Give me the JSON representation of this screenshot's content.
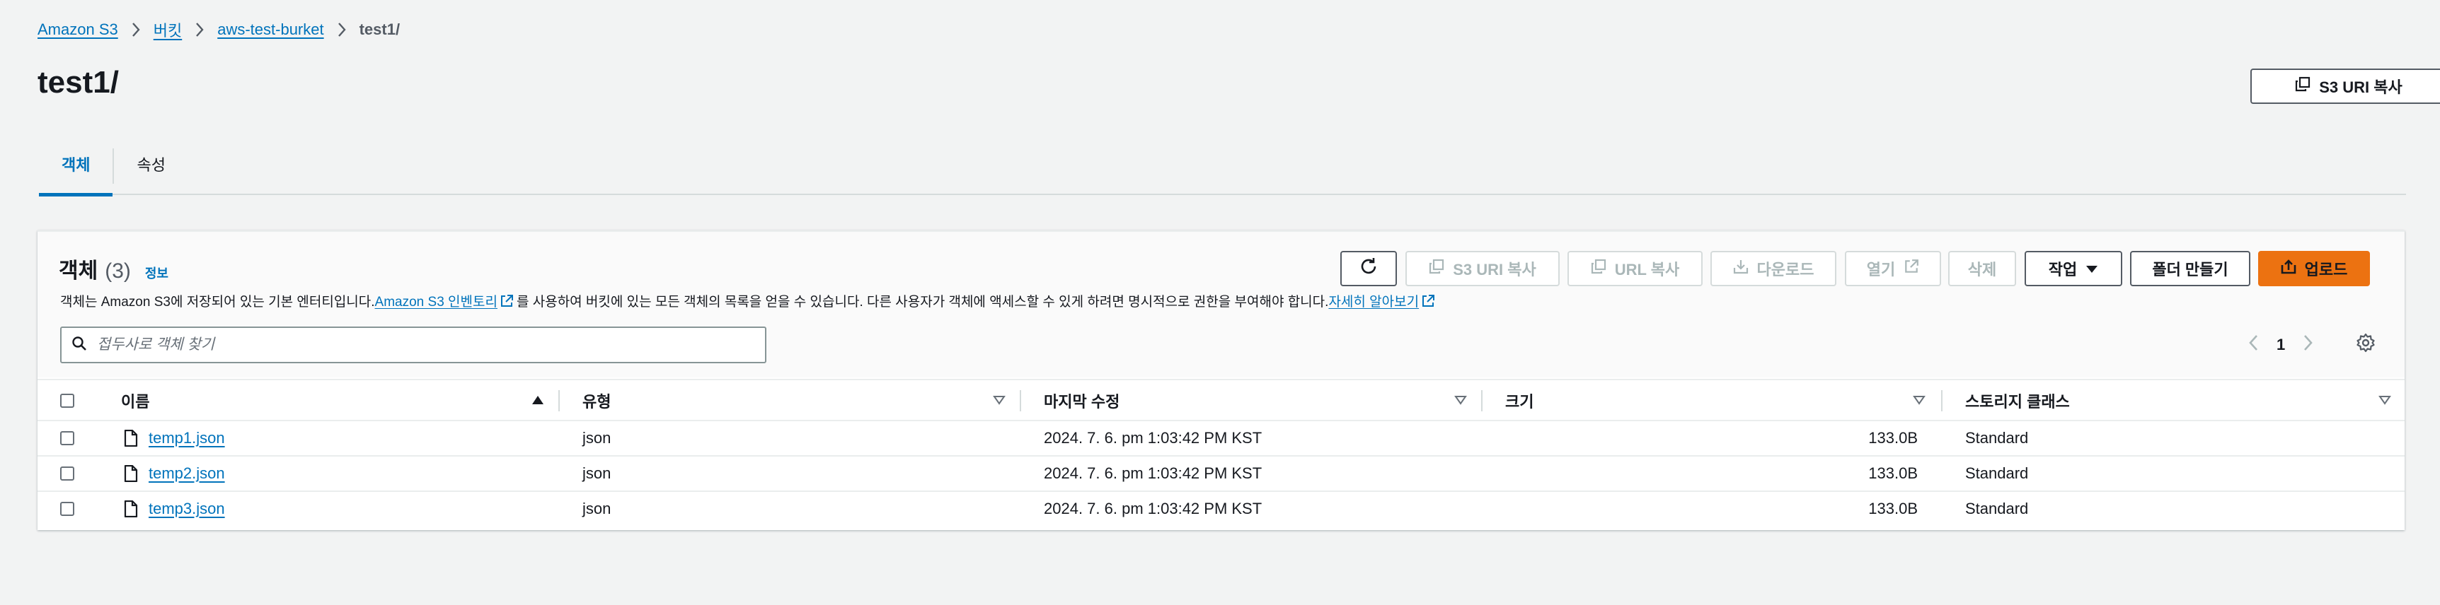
{
  "breadcrumb": {
    "items": [
      "Amazon S3",
      "버킷",
      "aws-test-burket"
    ],
    "current": "test1/"
  },
  "page": {
    "title": "test1/",
    "copy_uri_button": "S3 URI 복사"
  },
  "tabs": [
    {
      "label": "객체",
      "active": true
    },
    {
      "label": "속성",
      "active": false
    }
  ],
  "panel": {
    "title": "객체",
    "count": "(3)",
    "info_link": "정보",
    "description_1": "객체는 Amazon S3에 저장되어 있는 기본 엔터티입니다. ",
    "inventory_link": "Amazon S3 인벤토리",
    "description_2": "를 사용하여 버킷에 있는 모든 객체의 목록을 얻을 수 있습니다. 다른 사용자가 객체에 액세스할 수 있게 하려면 명시적으로 권한을 부여해야 합니다. ",
    "learn_more_link": "자세히 알아보기"
  },
  "toolbar": {
    "copy_s3_uri": "S3 URI 복사",
    "copy_url": "URL 복사",
    "download": "다운로드",
    "open": "열기",
    "delete": "삭제",
    "actions": "작업",
    "create_folder": "폴더 만들기",
    "upload": "업로드"
  },
  "search": {
    "placeholder": "접두사로 객체 찾기",
    "value": ""
  },
  "pagination": {
    "current_page": "1"
  },
  "table": {
    "columns": [
      "이름",
      "유형",
      "마지막 수정",
      "크기",
      "스토리지 클래스"
    ],
    "rows": [
      {
        "name": "temp1.json",
        "type": "json",
        "modified": "2024. 7. 6. pm 1:03:42 PM KST",
        "size": "133.0B",
        "storage": "Standard"
      },
      {
        "name": "temp2.json",
        "type": "json",
        "modified": "2024. 7. 6. pm 1:03:42 PM KST",
        "size": "133.0B",
        "storage": "Standard"
      },
      {
        "name": "temp3.json",
        "type": "json",
        "modified": "2024. 7. 6. pm 1:03:42 PM KST",
        "size": "133.0B",
        "storage": "Standard"
      }
    ]
  },
  "colors": {
    "link": "#0073bb",
    "primary_button": "#ec7211",
    "background": "#f2f3f3",
    "disabled_text": "#aab7b8"
  },
  "icons": {
    "copy": "copy-icon",
    "download": "download-icon",
    "external": "external-link-icon",
    "refresh": "refresh-icon",
    "upload": "upload-icon",
    "file": "file-icon",
    "settings": "gear-icon",
    "search": "search-icon"
  }
}
